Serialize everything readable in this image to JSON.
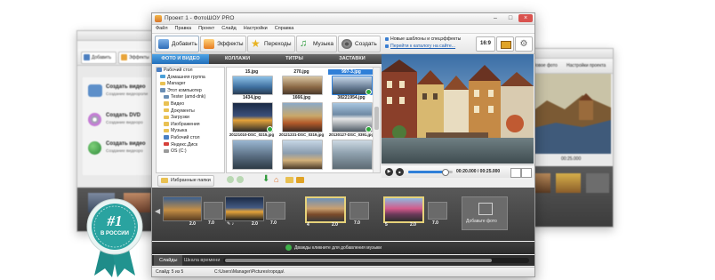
{
  "app": {
    "title": "Проект 1 - ФотоШОУ PRO"
  },
  "menu": [
    "Файл",
    "Правка",
    "Проект",
    "Слайд",
    "Настройки",
    "Справка"
  ],
  "toolbar": {
    "buttons": [
      "Добавить",
      "Эффекты",
      "Переходы",
      "Музыка",
      "Создать"
    ],
    "news_link": "Новые шаблоны и спецэффекты",
    "catalog_link": "Перейти к каталогу на сайте...",
    "aspect": "16:9"
  },
  "subtabs": [
    "ФОТО И ВИДЕО",
    "КОЛЛАЖИ",
    "ТИТРЫ",
    "ЗАСТАВКИ"
  ],
  "tree": [
    "Рабочий стол",
    "Домашняя группа",
    "Manager",
    "Этот компьютер",
    "Tester (amd-dnk)",
    "Видео",
    "Документы",
    "Загрузки",
    "Изображения",
    "Музыка",
    "Рабочий стол",
    "Яндекс.Диск",
    "OS (C:)"
  ],
  "files": {
    "names": [
      "15.jpg",
      "270.jpg",
      "997-3.jpg",
      "1434.jpg",
      "1666.jpg",
      "38221954.jpg",
      "20121010-DSC_0215.jpg",
      "20121231-DSC_0319.jpg",
      "20130127-DSC_0391.jpg"
    ],
    "selected_index": 2
  },
  "favorites_label": "Избранные папки",
  "player": {
    "time": "00:20.000 / 00:25.000"
  },
  "timeline": {
    "durations": [
      "2.0",
      "7.0",
      "2.0",
      "7.0",
      "2.0",
      "7.0",
      "2.0",
      "7.0"
    ],
    "slide_numbers": [
      "4",
      "5"
    ],
    "add_photo_label": "Добавьте фото"
  },
  "music_hint": "Дважды кликните для добавления музыки",
  "bottom_tabs": [
    "Слайды",
    "Шкала времени"
  ],
  "status": {
    "slide": "Слайд: 5 из 5",
    "path": "C:\\Users\\Manager\\Pictures\\города\\"
  },
  "left_window": {
    "items": [
      "Добавить",
      "Эффекты"
    ],
    "actions": [
      "Создать видео",
      "Создать DVD",
      "Создать видео"
    ],
    "sublines": [
      "Создание видеороли",
      "Создание видеоро",
      "Создание видеоро"
    ]
  },
  "right_window": {
    "labels": [
      "Новое фото",
      "Настройки проекта"
    ],
    "time": "00:25.000"
  },
  "badge": {
    "number": "#1",
    "text": "В РОССИИ"
  },
  "colors": {
    "accent": "#2f7fd8",
    "timeline_bg": "#4a4a4a",
    "badge": "#2aa3a0"
  }
}
